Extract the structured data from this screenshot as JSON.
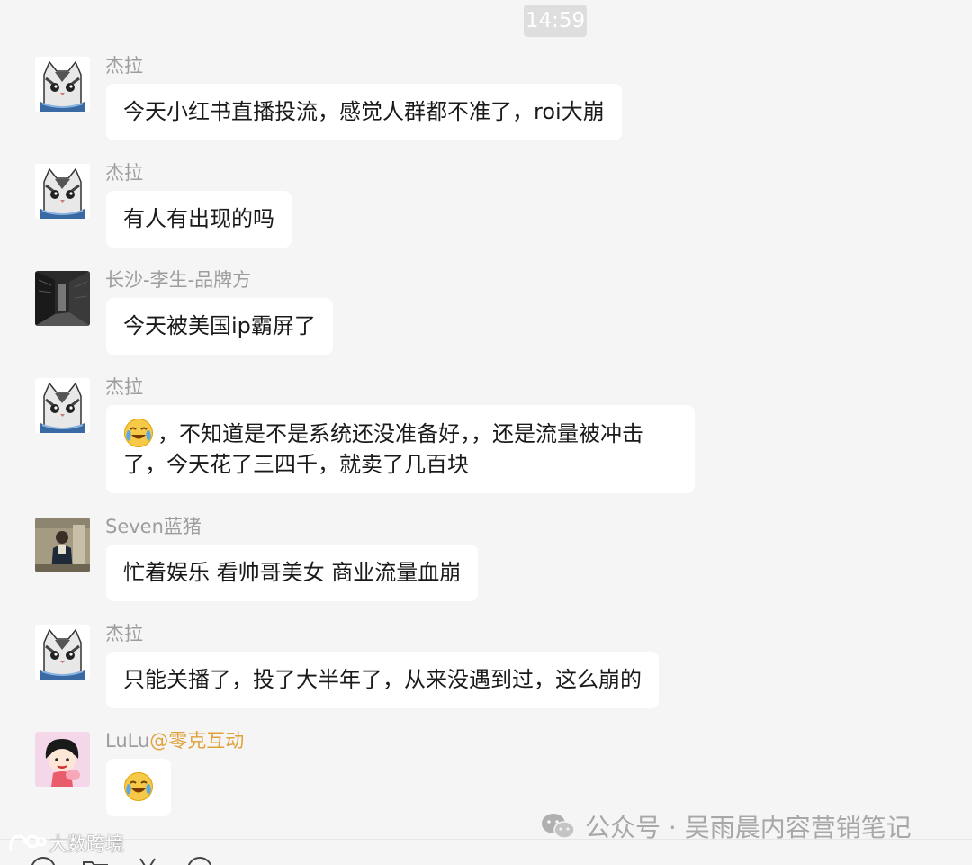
{
  "time_label": "14:59",
  "messages": [
    {
      "sender": "杰拉",
      "text": "今天小红书直播投流，感觉人群都不准了，roi大崩"
    },
    {
      "sender": "杰拉",
      "text": "有人有出现的吗"
    },
    {
      "sender": "长沙-李生-品牌方",
      "text": "今天被美国ip霸屏了"
    },
    {
      "sender": "杰拉",
      "emoji": "crying-laughing-emoji",
      "text": "，不知道是不是系统还没准备好，，还是流量被冲击了，今天花了三四千，就卖了几百块"
    },
    {
      "sender": "Seven蓝猪",
      "text": "忙着娱乐 看帅哥美女 商业流量血崩"
    },
    {
      "sender": "杰拉",
      "text": "只能关播了，投了大半年了，从来没遇到过，这么崩的"
    },
    {
      "sender": "LuLu",
      "sender_tag": "@零克互动",
      "emoji": "crying-laughing-emoji",
      "text": ""
    }
  ],
  "watermark": {
    "icon": "wechat-icon",
    "text": "公众号 · 吴雨晨内容营销笔记"
  },
  "brand_mark": {
    "icon": "brand-logo",
    "text": "大数跨境"
  },
  "colors": {
    "background": "#f5f5f5",
    "bubble": "#ffffff",
    "sender_name": "#9d9d9d",
    "sender_tag": "#e0a23b",
    "timestamp_bg": "#dedede"
  },
  "toolbar": [
    "emoji-icon",
    "folder-icon",
    "scissors-icon",
    "chat-history-icon"
  ]
}
